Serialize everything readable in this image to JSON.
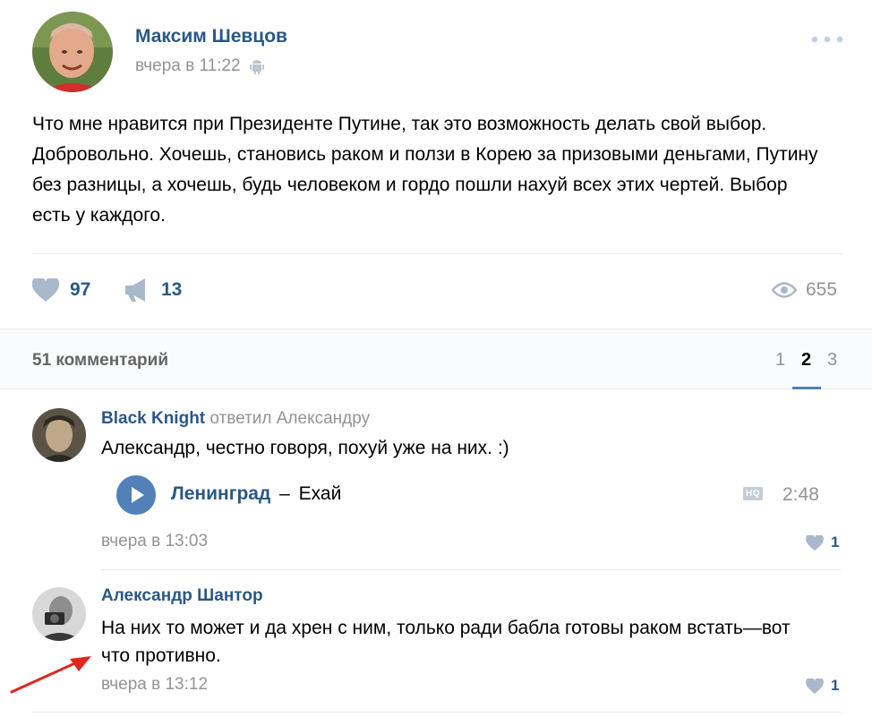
{
  "post": {
    "author": "Максим Шевцов",
    "time": "вчера в 11:22",
    "text": "Что мне нравится при Президенте Путине, так это возможность делать свой выбор. Добровольно. Хочешь, становись раком и ползи в Корею за призовыми деньгами, Путину без разницы, а хочешь, будь человеком и гордо пошли нахуй всех этих чертей. Выбор есть у каждого.",
    "likes": "97",
    "shares": "13",
    "views": "655"
  },
  "comments_header": {
    "count_label": "51 комментарий",
    "pages": [
      "1",
      "2",
      "3"
    ],
    "active_page": "2"
  },
  "comments": [
    {
      "author": "Black Knight",
      "reply_text": "ответил Александру",
      "text": "Александр, честно говоря, похуй уже на них. :)",
      "audio": {
        "artist": "Ленинград",
        "separator": "–",
        "title": "Ехай",
        "quality": "HQ",
        "duration": "2:48"
      },
      "time": "вчера в 13:03",
      "likes": "1"
    },
    {
      "author": "Александр Шантор",
      "text": "На них то может и да хрен с ним, только ради бабла готовы раком встать—вот что противно.",
      "time": "вчера в 13:12",
      "likes": "1"
    }
  ],
  "colors": {
    "link": "#2a5885",
    "muted": "#939393",
    "icon": "#a9b8ca",
    "arrow": "#e0271e"
  }
}
